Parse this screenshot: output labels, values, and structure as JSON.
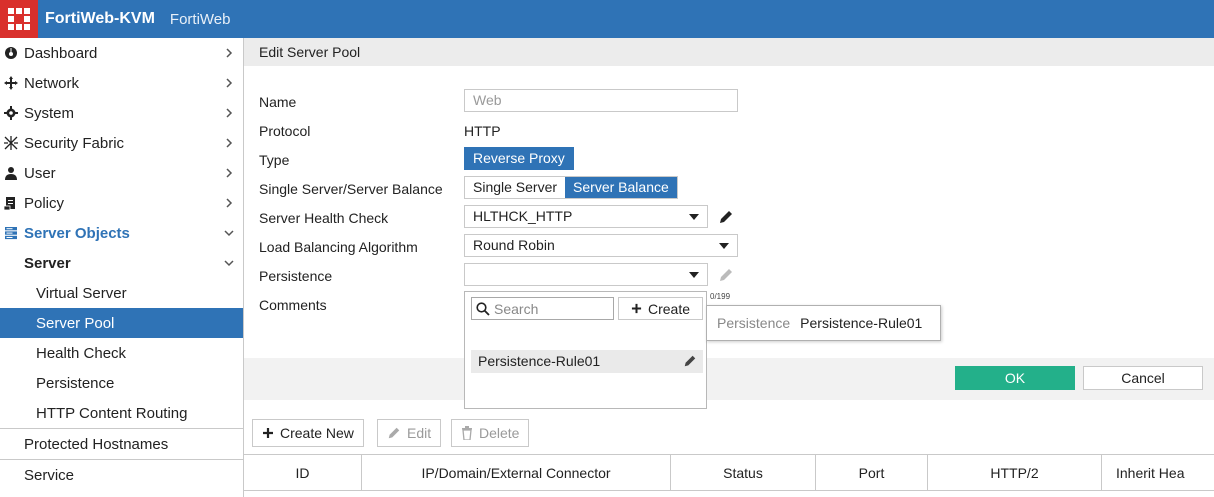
{
  "header": {
    "title": "FortiWeb-KVM",
    "subtitle": "FortiWeb"
  },
  "sidebar": {
    "items": [
      {
        "label": "Dashboard",
        "icon": "dashboard-icon"
      },
      {
        "label": "Network",
        "icon": "network-icon"
      },
      {
        "label": "System",
        "icon": "gear-icon"
      },
      {
        "label": "Security Fabric",
        "icon": "fabric-icon"
      },
      {
        "label": "User",
        "icon": "user-icon"
      },
      {
        "label": "Policy",
        "icon": "policy-icon"
      },
      {
        "label": "Server Objects",
        "icon": "server-icon"
      }
    ],
    "server_group": "Server",
    "server_children": [
      "Virtual Server",
      "Server Pool",
      "Health Check",
      "Persistence",
      "HTTP Content Routing"
    ],
    "after": [
      "Protected Hostnames",
      "Service"
    ]
  },
  "panel": {
    "title": "Edit Server Pool",
    "labels": {
      "name": "Name",
      "protocol": "Protocol",
      "type": "Type",
      "single_balance": "Single Server/Server Balance",
      "health_check": "Server Health Check",
      "algorithm": "Load Balancing Algorithm",
      "persistence": "Persistence",
      "comments": "Comments"
    },
    "name_placeholder": "Web",
    "protocol_value": "HTTP",
    "type_value": "Reverse Proxy",
    "single_option": "Single Server",
    "balance_option": "Server Balance",
    "health_check_value": "HLTHCK_HTTP",
    "algorithm_value": "Round Robin",
    "persistence_value": "",
    "comments_counter": "0/199",
    "dropdown": {
      "search_placeholder": "Search",
      "create_label": "Create",
      "item": "Persistence-Rule01"
    },
    "tooltip": {
      "key": "Persistence",
      "value": "Persistence-Rule01"
    },
    "ok_label": "OK",
    "cancel_label": "Cancel"
  },
  "toolbar": {
    "create_new": "Create New",
    "edit": "Edit",
    "delete": "Delete"
  },
  "table": {
    "columns": [
      "ID",
      "IP/Domain/External Connector",
      "Status",
      "Port",
      "HTTP/2",
      "Inherit Hea"
    ]
  },
  "colors": {
    "brand": "#2f73b6",
    "logo": "#d9302c",
    "ok": "#23b08a"
  }
}
